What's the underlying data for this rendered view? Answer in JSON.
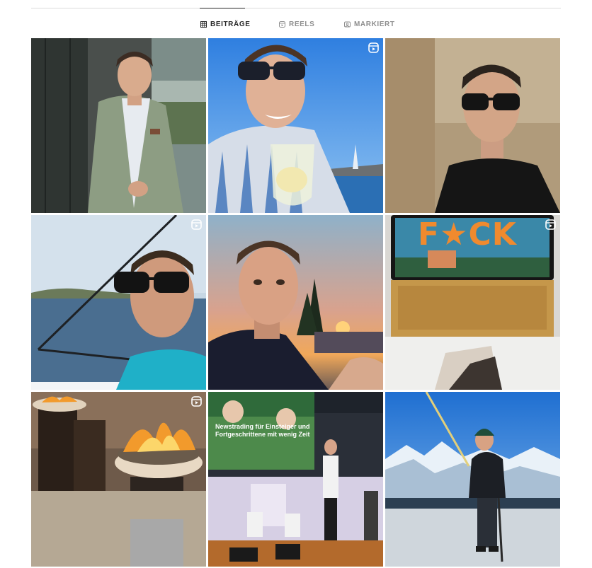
{
  "tabs": [
    {
      "label": "BEITRÄGE",
      "icon": "grid-icon",
      "active": true
    },
    {
      "label": "REELS",
      "icon": "reels-icon",
      "active": false
    },
    {
      "label": "MARKIERT",
      "icon": "tagged-icon",
      "active": false
    }
  ],
  "posts": [
    {
      "description": "man in grey suit smiling by window",
      "reel": false
    },
    {
      "description": "man in sunglasses holding wine glass by the sea",
      "reel": true
    },
    {
      "description": "selfie in black shirt and sunglasses",
      "reel": false
    },
    {
      "description": "selfie on boat wearing sunglasses",
      "reel": true
    },
    {
      "description": "selfie at sunset by the lake",
      "reel": false
    },
    {
      "description": "in-flight screen showing F*CK title",
      "reel": true,
      "screen_text": "F★CK"
    },
    {
      "description": "fire bowls in a lobby",
      "reel": true
    },
    {
      "description": "speaker on stage in front of presentation",
      "reel": false,
      "slide_text": "Newstrading für Einsteiger und Fortgeschrittene mit wenig Zeit"
    },
    {
      "description": "man on snowy mountain viewing platform",
      "reel": false
    }
  ]
}
